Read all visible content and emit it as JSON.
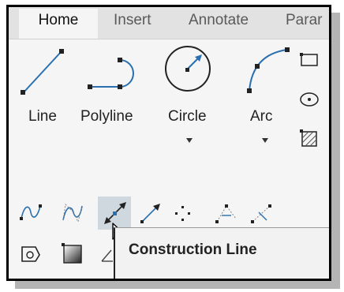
{
  "ribbon": {
    "tabs": [
      {
        "label": "Home",
        "active": true
      },
      {
        "label": "Insert",
        "active": false
      },
      {
        "label": "Annotate",
        "active": false
      },
      {
        "label": "Parar",
        "active": false
      }
    ],
    "draw_tools": [
      {
        "label": "Line",
        "icon": "line-icon"
      },
      {
        "label": "Polyline",
        "icon": "polyline-icon"
      },
      {
        "label": "Circle",
        "icon": "circle-icon",
        "has_dropdown": true
      },
      {
        "label": "Arc",
        "icon": "arc-icon",
        "has_dropdown": true
      }
    ],
    "small_tools": [
      "rectangle-icon",
      "ellipse-icon",
      "hatch-icon"
    ],
    "expanded_tools": [
      "spline-fit-icon",
      "spline-cv-icon",
      "construction-line-icon",
      "ray-icon",
      "multiple-points-icon",
      "divide-icon",
      "measure-icon",
      "region-icon",
      "gradient-icon",
      "wipeout-icon"
    ],
    "hovered_tool": "construction-line-icon"
  },
  "tooltip": {
    "title": "Construction Line"
  },
  "colors": {
    "accent_blue": "#2a6fb0",
    "hover_bg": "#cfd8de",
    "tab_bar": "#e2e2e2"
  }
}
